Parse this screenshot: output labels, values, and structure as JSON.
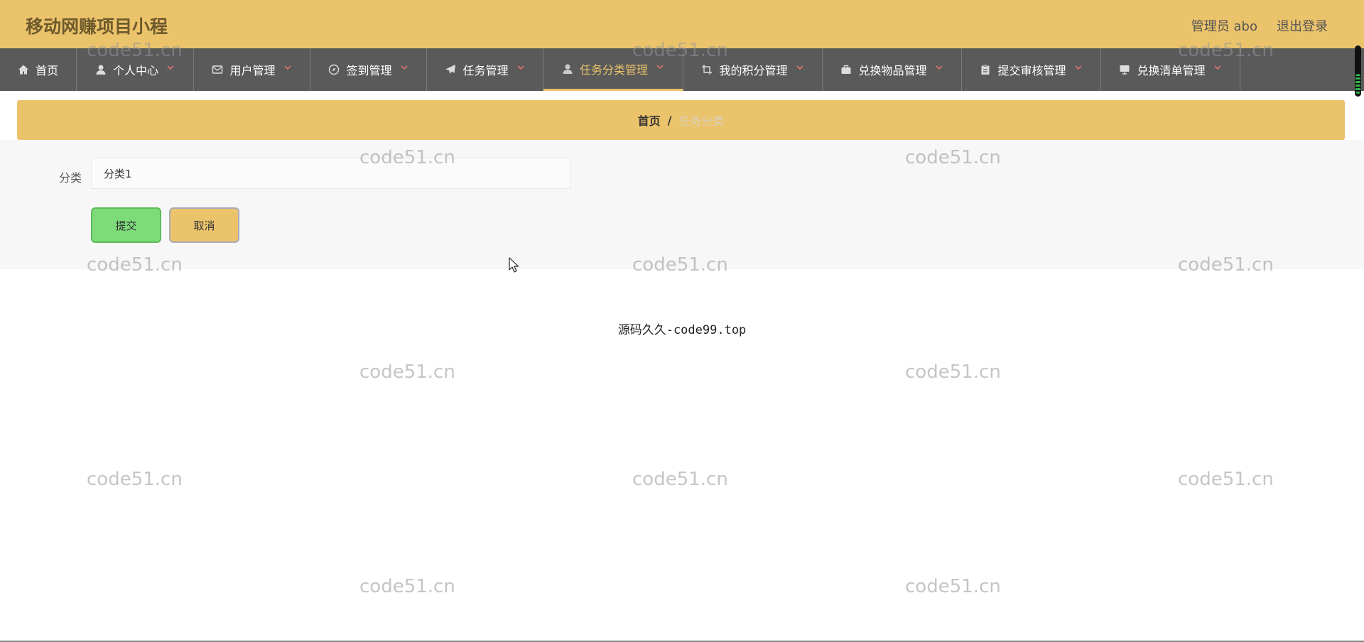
{
  "header": {
    "app_title": "移动网赚项目小程",
    "admin_label": "管理员 abo",
    "logout": "退出登录"
  },
  "nav": [
    {
      "label": "首页",
      "icon": "home-icon",
      "active": false
    },
    {
      "label": "个人中心",
      "icon": "person-icon",
      "active": false
    },
    {
      "label": "用户管理",
      "icon": "mail-icon",
      "active": false
    },
    {
      "label": "签到管理",
      "icon": "compass-icon",
      "active": false
    },
    {
      "label": "任务管理",
      "icon": "send-icon",
      "active": false
    },
    {
      "label": "任务分类管理",
      "icon": "person-icon",
      "active": true
    },
    {
      "label": "我的积分管理",
      "icon": "crop-icon",
      "active": false
    },
    {
      "label": "兑换物品管理",
      "icon": "briefcase-icon",
      "active": false
    },
    {
      "label": "提交审核管理",
      "icon": "clipboard-icon",
      "active": false
    },
    {
      "label": "兑换清单管理",
      "icon": "monitor-icon",
      "active": false
    }
  ],
  "breadcrumb": {
    "home": "首页",
    "separator": "/",
    "current": "任务分类"
  },
  "form": {
    "category_label": "分类",
    "category_value": "分类1",
    "submit_label": "提交",
    "cancel_label": "取消"
  },
  "footer_text": "源码久久-code99.top",
  "watermark_text": "code51.cn",
  "colors": {
    "accent": "#ebc36b",
    "navbar": "#5a5a5a",
    "submit": "#7ddb7a"
  }
}
